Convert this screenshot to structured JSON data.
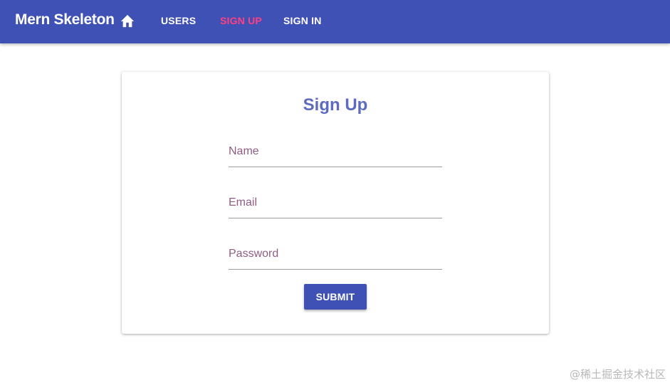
{
  "appbar": {
    "title": "Mern Skeleton",
    "home_icon": "home-icon",
    "links": [
      {
        "label": "USERS",
        "active": false
      },
      {
        "label": "SIGN UP",
        "active": true
      },
      {
        "label": "SIGN IN",
        "active": false
      }
    ],
    "link_color": "#ffffff",
    "active_link_color": "#ff4081",
    "background_color": "#3f51b5"
  },
  "form": {
    "title": "Sign Up",
    "fields": [
      {
        "label": "Name",
        "value": ""
      },
      {
        "label": "Email",
        "value": ""
      },
      {
        "label": "Password",
        "value": ""
      }
    ],
    "submit_label": "SUBMIT"
  },
  "watermark": "@稀土掘金技术社区"
}
